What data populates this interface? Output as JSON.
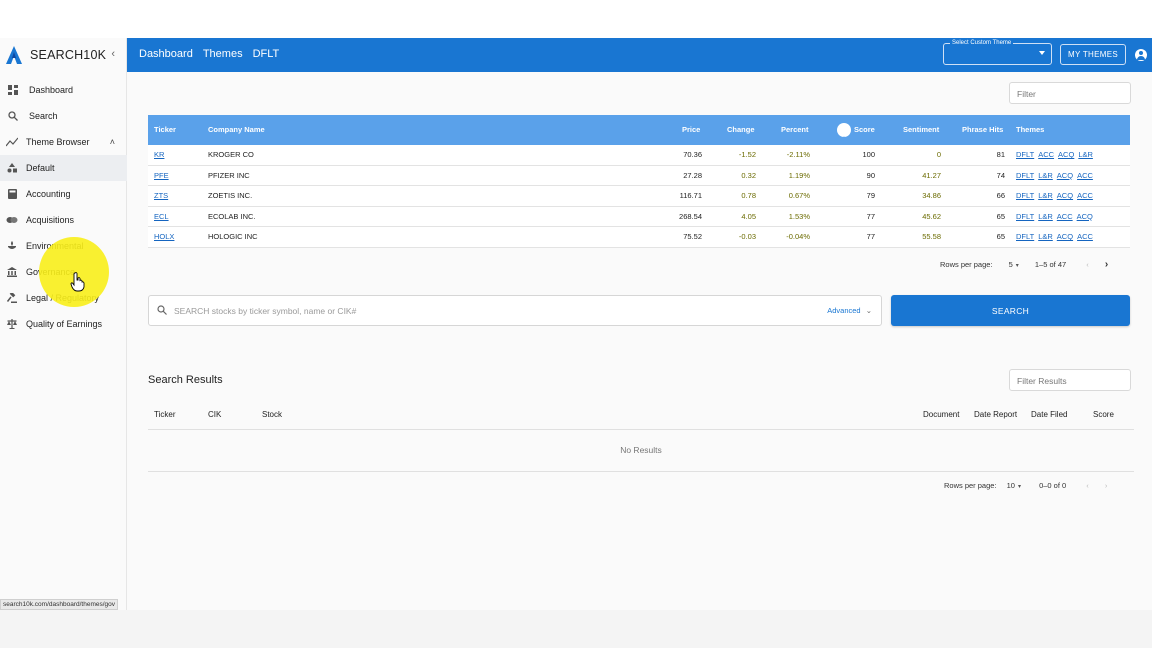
{
  "app": {
    "name": "SEARCH10K",
    "collapse_icon": "chevron-left-icon"
  },
  "sidebar": {
    "items": [
      {
        "label": "Dashboard",
        "icon": "dashboard-icon"
      },
      {
        "label": "Search",
        "icon": "search-icon"
      },
      {
        "label": "Theme Browser",
        "icon": "trend-icon"
      },
      {
        "label": "Default",
        "icon": "shapes-icon"
      },
      {
        "label": "Accounting",
        "icon": "calculator-icon"
      },
      {
        "label": "Acquisitions",
        "icon": "handshake-icon"
      },
      {
        "label": "Environmental",
        "icon": "leaf-icon"
      },
      {
        "label": "Governance",
        "icon": "bank-icon"
      },
      {
        "label": "Legal / Regulatory",
        "icon": "gavel-icon"
      },
      {
        "label": "Quality of Earnings",
        "icon": "scale-icon"
      }
    ],
    "status_url": "search10k.com/dashboard/themes/gov"
  },
  "topbar": {
    "breadcrumbs": [
      "Dashboard",
      "Themes",
      "DFLT"
    ],
    "custom_theme_label": "Select Custom Theme",
    "my_themes_label": "MY THEMES"
  },
  "themes_table": {
    "filter_placeholder": "Filter",
    "columns": [
      "Ticker",
      "Company Name",
      "Price",
      "Change",
      "Percent",
      "Score",
      "Sentiment",
      "Phrase Hits",
      "Themes"
    ],
    "rows": [
      {
        "ticker": "KR",
        "company": "KROGER CO",
        "price": "70.36",
        "change": "-1.52",
        "percent": "-2.11%",
        "score": "100",
        "sentiment": "0",
        "hits": "81",
        "themes": [
          "DFLT",
          "ACC",
          "ACQ",
          "L&R"
        ]
      },
      {
        "ticker": "PFE",
        "company": "PFIZER INC",
        "price": "27.28",
        "change": "0.32",
        "percent": "1.19%",
        "score": "90",
        "sentiment": "41.27",
        "hits": "74",
        "themes": [
          "DFLT",
          "L&R",
          "ACQ",
          "ACC"
        ]
      },
      {
        "ticker": "ZTS",
        "company": "ZOETIS INC.",
        "price": "116.71",
        "change": "0.78",
        "percent": "0.67%",
        "score": "79",
        "sentiment": "34.86",
        "hits": "66",
        "themes": [
          "DFLT",
          "L&R",
          "ACQ",
          "ACC"
        ]
      },
      {
        "ticker": "ECL",
        "company": "ECOLAB INC.",
        "price": "268.54",
        "change": "4.05",
        "percent": "1.53%",
        "score": "77",
        "sentiment": "45.62",
        "hits": "65",
        "themes": [
          "DFLT",
          "L&R",
          "ACC",
          "ACQ"
        ]
      },
      {
        "ticker": "HOLX",
        "company": "HOLOGIC INC",
        "price": "75.52",
        "change": "-0.03",
        "percent": "-0.04%",
        "score": "77",
        "sentiment": "55.58",
        "hits": "65",
        "themes": [
          "DFLT",
          "L&R",
          "ACQ",
          "ACC"
        ]
      }
    ],
    "pagination": {
      "rows_per_page_label": "Rows per page:",
      "rows_per_page": "5",
      "range": "1–5 of 47"
    }
  },
  "search": {
    "placeholder": "SEARCH stocks by ticker symbol, name or CIK#",
    "advanced_label": "Advanced",
    "button_label": "SEARCH"
  },
  "search_results": {
    "title": "Search Results",
    "filter_placeholder": "Filter Results",
    "columns": [
      "Ticker",
      "CIK",
      "Stock",
      "Document",
      "Date Report",
      "Date Filed",
      "Score"
    ],
    "empty_text": "No Results",
    "pagination": {
      "rows_per_page_label": "Rows per page:",
      "rows_per_page": "10",
      "range": "0–0 of 0"
    }
  },
  "colors": {
    "topbar": "#1976d2",
    "table_header": "#5aa1ea",
    "highlight": "#f8ee1a"
  }
}
